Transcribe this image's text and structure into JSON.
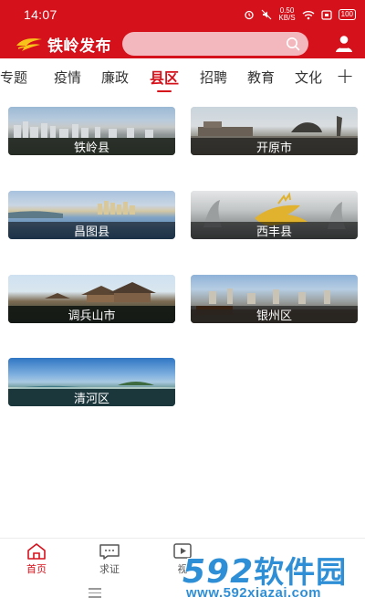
{
  "status_bar": {
    "time": "14:07",
    "net_speed_value": "0.50",
    "net_speed_unit": "KB/S",
    "battery": "100"
  },
  "header": {
    "app_name": "铁岭发布",
    "search_placeholder": "",
    "brand_color": "#d5121c"
  },
  "tabs": {
    "items": [
      "专题",
      "疫情",
      "廉政",
      "县区",
      "招聘",
      "教育",
      "文化"
    ],
    "active_index": 3,
    "add_symbol": "+"
  },
  "counties": [
    {
      "name": "铁岭县"
    },
    {
      "name": "开原市"
    },
    {
      "name": "昌图县"
    },
    {
      "name": "西丰县"
    },
    {
      "name": "调兵山市"
    },
    {
      "name": "银州区"
    },
    {
      "name": "清河区"
    }
  ],
  "bottom_nav": {
    "items": [
      {
        "label": "首页",
        "icon": "home-icon",
        "active": true
      },
      {
        "label": "求证",
        "icon": "chat-icon",
        "active": false
      },
      {
        "label": "视",
        "icon": "video-icon",
        "active": false
      }
    ]
  },
  "watermark": {
    "brand_number": "592",
    "brand_cn": "软件园",
    "url": "www.592xiazai.com"
  }
}
